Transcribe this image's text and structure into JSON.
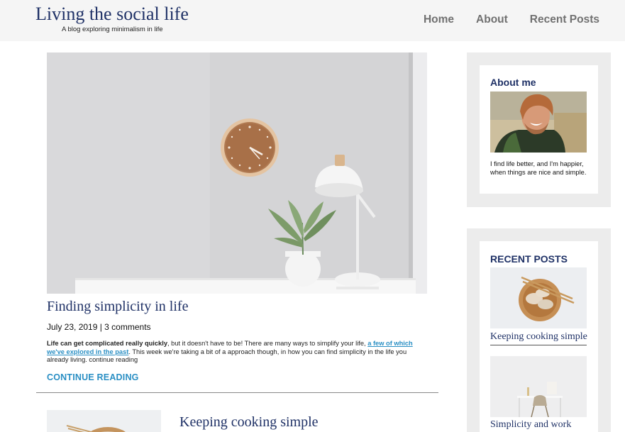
{
  "header": {
    "site_title": "Living the social life",
    "tagline": "A blog exploring minimalism in life",
    "nav": [
      {
        "label": "Home"
      },
      {
        "label": "About"
      },
      {
        "label": "Recent Posts"
      }
    ]
  },
  "featured_post": {
    "title": "Finding simplicity in life",
    "meta": "July 23, 2019 | 3 comments",
    "excerpt_bold": "Life can get complicated really quickly",
    "excerpt_part1": ", but it doesn't have to be! There are many ways to simplify your life, ",
    "excerpt_link": "a few of which we've explored in the past",
    "excerpt_part2": ". This week we're taking a bit of a approach though, in how you can find simplicity in the life you already living. continue reading",
    "continue_label": "CONTINUE READING",
    "image_icon": "wall-clock-lamp-plant-photo"
  },
  "second_post": {
    "title": "Keeping cooking simple"
  },
  "sidebar": {
    "about": {
      "title": "About me",
      "text": "I find life better, and I'm happier, when things are nice and simple.",
      "image_icon": "smiling-man-photo"
    },
    "recent": {
      "title": "RECENT POSTS",
      "items": [
        {
          "label": "Keeping cooking simple",
          "image_icon": "dumplings-bowl-photo"
        },
        {
          "label": "Simplicity and work",
          "image_icon": "desk-chair-photo"
        }
      ]
    }
  },
  "colors": {
    "title_navy": "#1f3166",
    "link_blue": "#2a8fc4",
    "nav_gray": "#707070",
    "header_bg": "#f5f5f5",
    "widget_bg": "#ececec"
  }
}
